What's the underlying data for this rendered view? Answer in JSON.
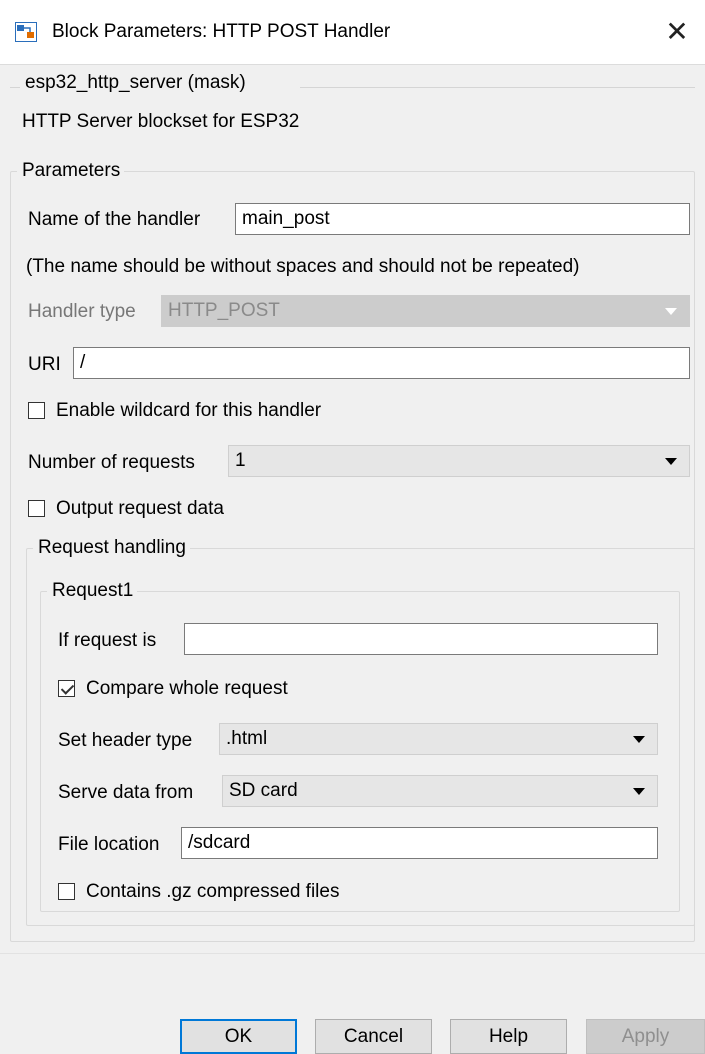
{
  "window": {
    "title": "Block Parameters: HTTP POST Handler",
    "close_glyph": "✕"
  },
  "mask": {
    "name": "esp32_http_server (mask)",
    "description": "HTTP Server blockset for ESP32"
  },
  "parameters": {
    "legend": "Parameters",
    "handler_name": {
      "label": "Name of the handler",
      "value": "main_post"
    },
    "handler_note": "(The name should be without spaces and should not be repeated)",
    "handler_type": {
      "label": "Handler type",
      "value": "HTTP_POST"
    },
    "uri": {
      "label": "URI",
      "value": "/"
    },
    "wildcard": {
      "label": "Enable wildcard for this handler",
      "checked": false
    },
    "num_requests": {
      "label": "Number of requests",
      "value": "1"
    },
    "output_request": {
      "label": "Output request data",
      "checked": false
    }
  },
  "request_handling": {
    "legend": "Request handling",
    "request1": {
      "legend": "Request1",
      "if_request": {
        "label": "If request is",
        "value": ""
      },
      "compare_whole": {
        "label": "Compare whole request",
        "checked": true
      },
      "header_type": {
        "label": "Set header type",
        "value": ".html"
      },
      "serve_from": {
        "label": "Serve data from",
        "value": "SD card"
      },
      "file_location": {
        "label": "File location",
        "value": "/sdcard"
      },
      "gz": {
        "label": "Contains .gz compressed files",
        "checked": false
      }
    }
  },
  "buttons": {
    "ok": "OK",
    "cancel": "Cancel",
    "help": "Help",
    "apply": "Apply"
  },
  "colors": {
    "accent": "#0078d7",
    "disabled": "#cccccc",
    "background": "#f0f0f0"
  }
}
